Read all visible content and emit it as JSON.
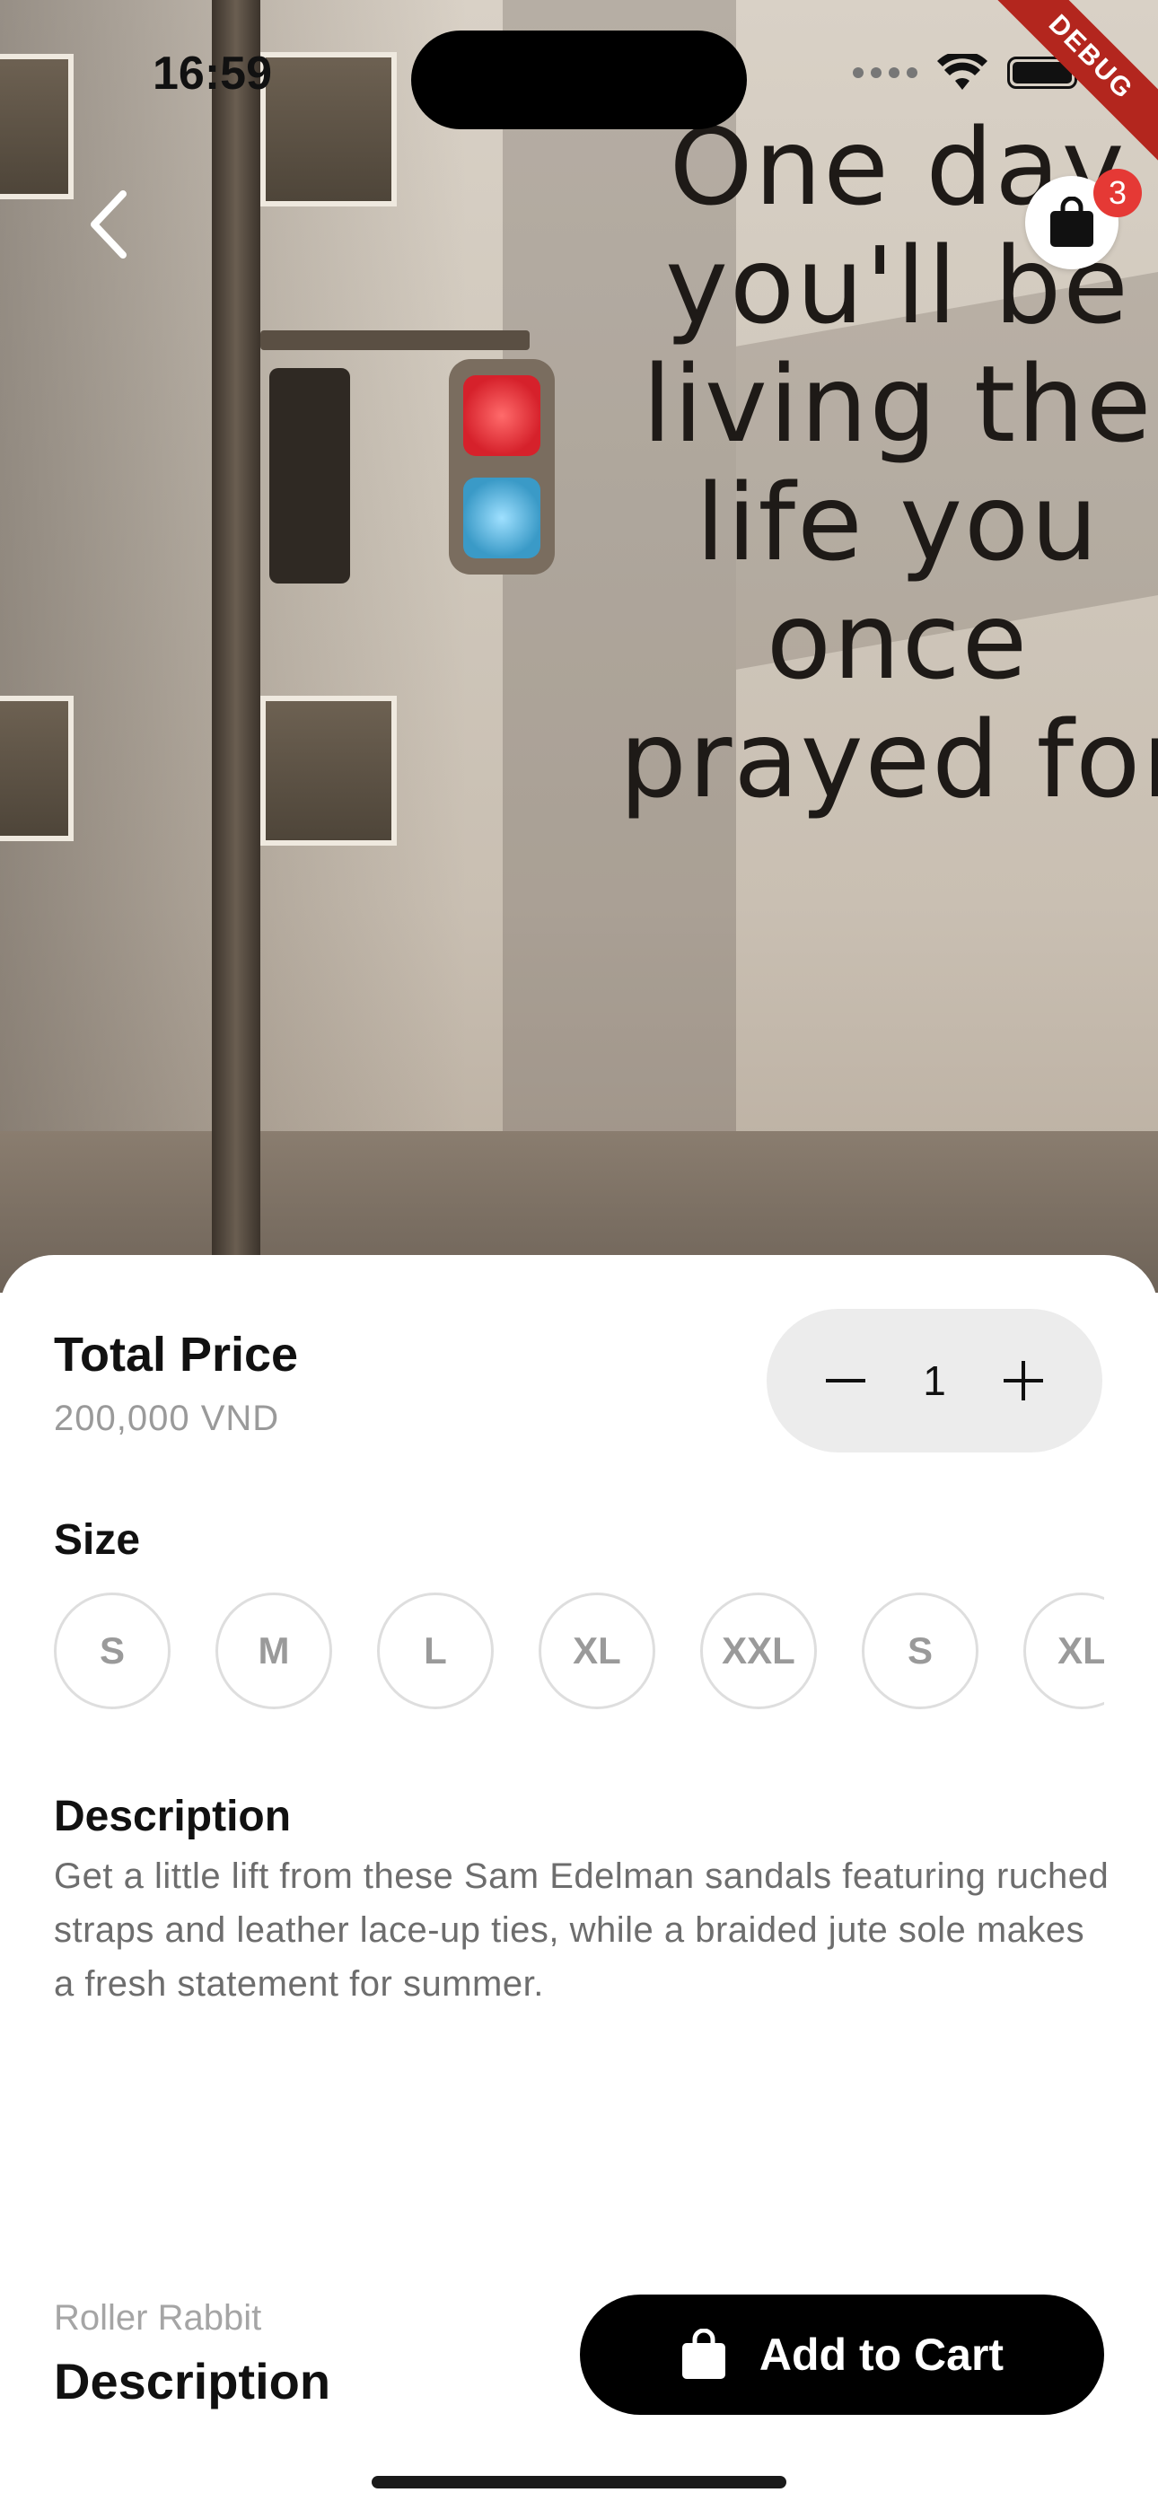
{
  "status_bar": {
    "time": "16:59"
  },
  "debug_banner": "DEBUG",
  "hero": {
    "wall_text": [
      "One day",
      "you'll be",
      "living the",
      "life you",
      "once",
      "prayed for"
    ]
  },
  "header": {
    "cart_count": "3"
  },
  "product": {
    "total_price_label": "Total Price",
    "total_price_value": "200,000 VND",
    "quantity": "1",
    "size_label": "Size",
    "sizes": [
      "S",
      "M",
      "L",
      "XL",
      "XXL",
      "S",
      "XL"
    ],
    "description_label": "Description",
    "description": "Get a little lift from these Sam Edelman sandals featuring ruched straps and leather lace-up ties, while a braided jute sole makes a fresh statement for summer.",
    "brand": "Roller Rabbit",
    "name": "Description"
  },
  "actions": {
    "add_to_cart": "Add to Cart"
  },
  "colors": {
    "primary": "#000000",
    "badge": "#e53935",
    "debug": "#b3261e"
  }
}
